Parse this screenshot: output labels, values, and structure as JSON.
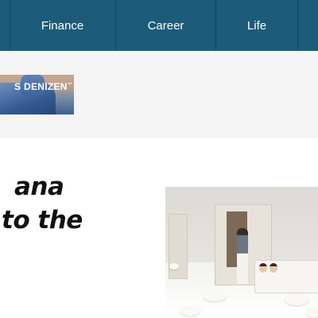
{
  "nav": {
    "items": [
      {
        "label": "Finance"
      },
      {
        "label": "Career"
      },
      {
        "label": "Life"
      }
    ],
    "background": "#1c5b79"
  },
  "ad": {
    "brand": "DENIZEN",
    "trademark": "™",
    "logo_mark": "S"
  },
  "article": {
    "headline_lines": [
      "ana",
      "to the"
    ]
  },
  "colors": {
    "nav_bg": "#1c5b79",
    "banner_bg": "#f5f5f5",
    "headline": "#111111"
  }
}
